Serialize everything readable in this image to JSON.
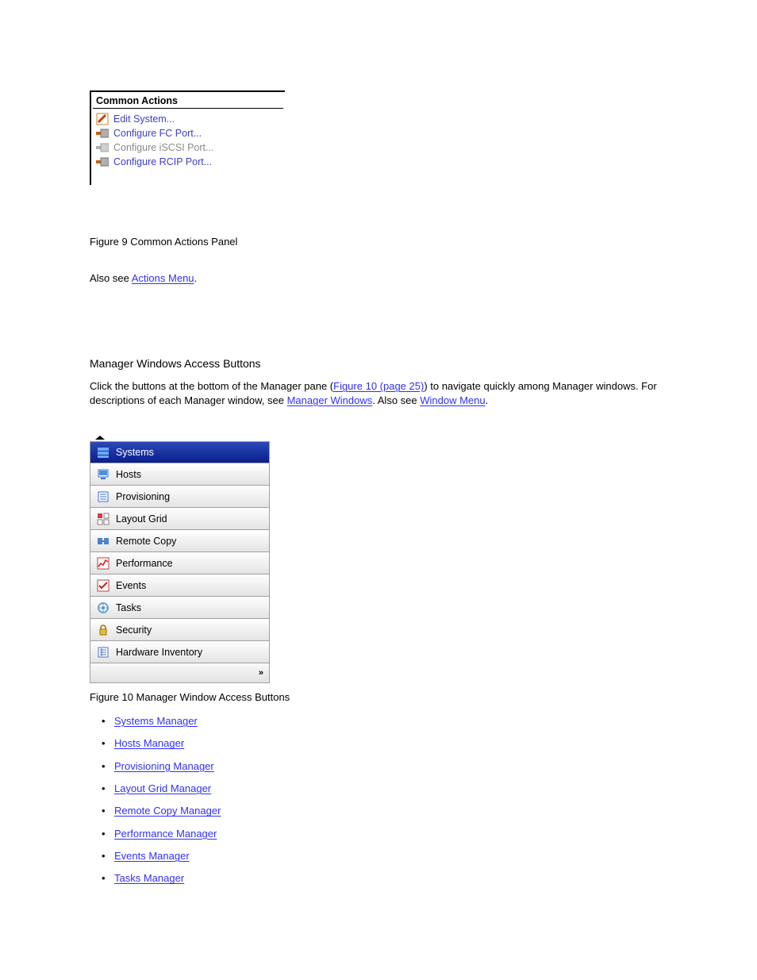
{
  "common_actions": {
    "header": "Common Actions",
    "items": [
      {
        "label": "Edit System...",
        "enabled": true,
        "icon": "edit-system-icon"
      },
      {
        "label": "Configure FC Port...",
        "enabled": true,
        "icon": "port-icon"
      },
      {
        "label": "Configure iSCSI Port...",
        "enabled": false,
        "icon": "port-disabled-icon"
      },
      {
        "label": "Configure RCIP Port...",
        "enabled": true,
        "icon": "port-icon"
      }
    ]
  },
  "figure_caption": "Figure 9 Common Actions Panel",
  "body": {
    "p1a": "Also see ",
    "p1_link": "Actions Menu",
    "p1b": ".",
    "h_manager_windows": "Manager Windows Access Buttons",
    "p2a": "Click the buttons at the bottom of the Manager pane (",
    "p2_link": "Figure 10 (page 25)",
    "p2b": ") to navigate quickly among Manager windows. For descriptions of each Manager window, see ",
    "p2_link2": "Manager Windows",
    "p2c": ". Also see ",
    "p2_link3": "Window Menu",
    "p2d": "."
  },
  "manager_panel": {
    "items": [
      {
        "label": "Systems",
        "icon": "systems-icon",
        "selected": true
      },
      {
        "label": "Hosts",
        "icon": "hosts-icon",
        "selected": false
      },
      {
        "label": "Provisioning",
        "icon": "provisioning-icon",
        "selected": false
      },
      {
        "label": "Layout Grid",
        "icon": "layout-grid-icon",
        "selected": false
      },
      {
        "label": "Remote Copy",
        "icon": "remote-copy-icon",
        "selected": false
      },
      {
        "label": "Performance",
        "icon": "performance-icon",
        "selected": false
      },
      {
        "label": "Events",
        "icon": "events-icon",
        "selected": false
      },
      {
        "label": "Tasks",
        "icon": "tasks-icon",
        "selected": false
      },
      {
        "label": "Security",
        "icon": "security-icon",
        "selected": false
      },
      {
        "label": "Hardware Inventory",
        "icon": "hardware-icon",
        "selected": false
      }
    ],
    "more_label": "»"
  },
  "figure_caption_2": "Figure 10 Manager Window Access Buttons",
  "bullets": {
    "items": [
      {
        "label": "Systems Manager",
        "page_ref": ""
      },
      {
        "label": "Hosts Manager",
        "page_ref": ""
      },
      {
        "label": "Provisioning Manager",
        "page_ref": ""
      },
      {
        "label": "Layout Grid Manager",
        "page_ref": ""
      },
      {
        "label": "Remote Copy Manager",
        "page_ref": ""
      },
      {
        "label": "Performance Manager",
        "page_ref": ""
      },
      {
        "label": "Events Manager",
        "page_ref": ""
      },
      {
        "label": "Tasks Manager",
        "page_ref": ""
      }
    ]
  }
}
